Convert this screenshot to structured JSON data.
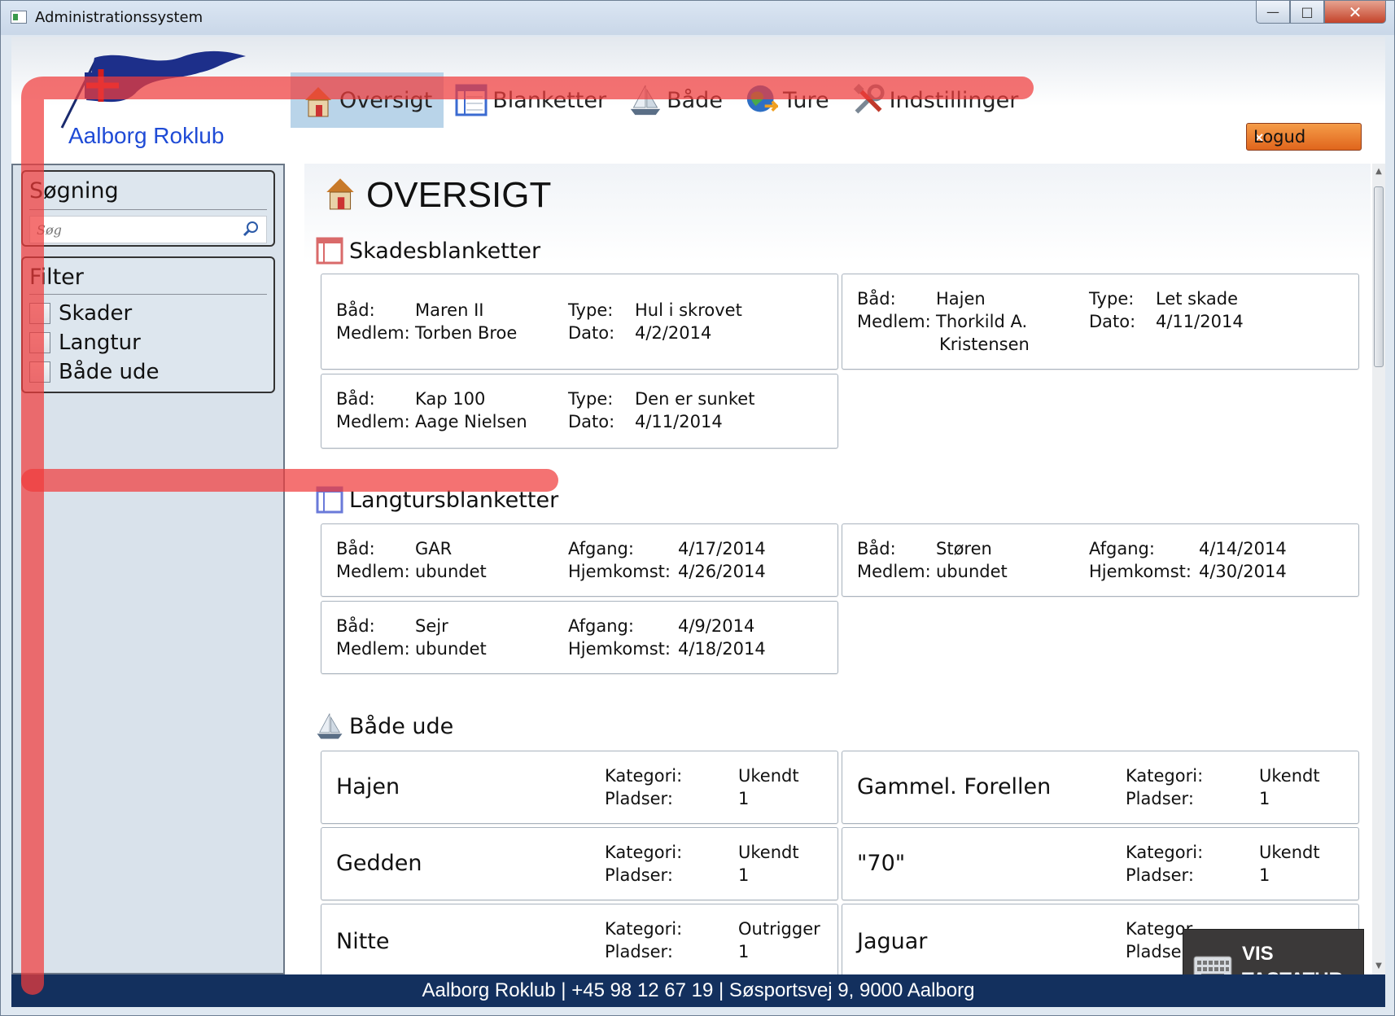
{
  "window": {
    "title": "Administrationssystem",
    "controls": [
      "—",
      "□",
      "✕"
    ]
  },
  "header": {
    "club_name": "Aalborg Roklub",
    "nav": [
      {
        "label": "Oversigt",
        "icon": "house-icon",
        "active": true
      },
      {
        "label": "Blanketter",
        "icon": "form-icon",
        "active": false
      },
      {
        "label": "Både",
        "icon": "sailboat-icon",
        "active": false
      },
      {
        "label": "Ture",
        "icon": "globe-arrow-icon",
        "active": false
      },
      {
        "label": "Indstillinger",
        "icon": "tools-icon",
        "active": false
      }
    ],
    "logout_label": "Logud",
    "logout_close": "×"
  },
  "sidebar": {
    "search": {
      "title": "Søgning",
      "placeholder": "Søg"
    },
    "filter": {
      "title": "Filter",
      "options": [
        "Skader",
        "Langtur",
        "Både ude"
      ]
    }
  },
  "main": {
    "title": "OVERSIGT",
    "damage": {
      "title": "Skadesblanketter",
      "labels": {
        "boat": "Båd:",
        "member": "Medlem:",
        "type": "Type:",
        "date": "Dato:"
      },
      "cards": [
        {
          "boat": "Maren II",
          "member": "Torben Broe",
          "member2": "",
          "type": "Hul i skrovet",
          "date": "4/2/2014"
        },
        {
          "boat": "Hajen",
          "member": "Thorkild A.",
          "member2": "Kristensen",
          "type": "Let skade",
          "date": "4/11/2014"
        },
        {
          "boat": "Kap 100",
          "member": "Aage Nielsen",
          "member2": "",
          "type": "Den er sunket",
          "date": "4/11/2014"
        }
      ]
    },
    "longtrip": {
      "title": "Langtursblanketter",
      "labels": {
        "boat": "Båd:",
        "member": "Medlem:",
        "departure": "Afgang:",
        "return": "Hjemkomst:"
      },
      "cards": [
        {
          "boat": "GAR",
          "member": "ubundet",
          "departure": "4/17/2014",
          "return": "4/26/2014"
        },
        {
          "boat": "Støren",
          "member": "ubundet",
          "departure": "4/14/2014",
          "return": "4/30/2014"
        },
        {
          "boat": "Sejr",
          "member": "ubundet",
          "departure": "4/9/2014",
          "return": "4/18/2014"
        }
      ]
    },
    "boats_out": {
      "title": "Både ude",
      "labels": {
        "category": "Kategori:",
        "seats": "Pladser:"
      },
      "cards": [
        {
          "name": "Hajen",
          "category": "Ukendt",
          "seats": "1"
        },
        {
          "name": "Gammel. Forellen",
          "category": "Ukendt",
          "seats": "1"
        },
        {
          "name": "Gedden",
          "category": "Ukendt",
          "seats": "1"
        },
        {
          "name": "\"70\"",
          "category": "Ukendt",
          "seats": "1"
        },
        {
          "name": "Nitte",
          "category": "Outrigger",
          "seats": "1"
        },
        {
          "name": "Jaguar",
          "category": "",
          "seats": ""
        }
      ],
      "partial_labels": {
        "category": "Kategor",
        "seats": "Pladser:"
      }
    }
  },
  "keyboard": {
    "line1": "VIS",
    "line2": "TASTATUR"
  },
  "footer": {
    "text": "Aalborg Roklub | +45 98 12 67 19 | Søsportsvej 9, 9000 Aalborg"
  },
  "colors": {
    "accent_blue": "#1f4bd6",
    "footer_bg": "#13305e",
    "logout_orange": "#e0651c",
    "active_tab": "#b9d4e9",
    "overlay_red": "#f03c3c"
  }
}
